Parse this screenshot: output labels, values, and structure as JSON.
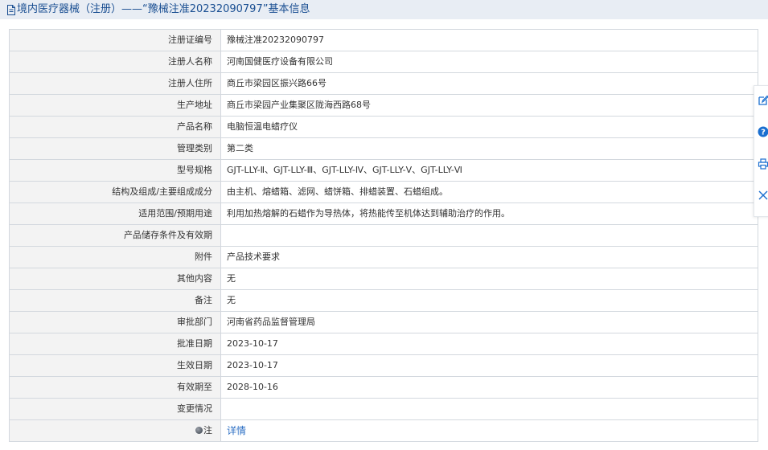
{
  "header": {
    "title": "境内医疗器械（注册）——“豫械注准20232090797”基本信息"
  },
  "rows": [
    {
      "label": "注册证编号",
      "value": "豫械注准20232090797"
    },
    {
      "label": "注册人名称",
      "value": "河南国健医疗设备有限公司"
    },
    {
      "label": "注册人住所",
      "value": "商丘市梁园区振兴路66号"
    },
    {
      "label": "生产地址",
      "value": "商丘市梁园产业集聚区陇海西路68号"
    },
    {
      "label": "产品名称",
      "value": "电脑恒温电蜡疗仪"
    },
    {
      "label": "管理类别",
      "value": "第二类"
    },
    {
      "label": "型号规格",
      "value": "GJT-LLY-Ⅱ、GJT-LLY-Ⅲ、GJT-LLY-Ⅳ、GJT-LLY-Ⅴ、GJT-LLY-Ⅵ"
    },
    {
      "label": "结构及组成/主要组成成分",
      "value": "由主机、熔蜡箱、滤网、蜡饼箱、排蜡装置、石蜡组成。"
    },
    {
      "label": "适用范围/预期用途",
      "value": "利用加热熔解的石蜡作为导热体，将热能传至机体达到辅助治疗的作用。"
    },
    {
      "label": "产品储存条件及有效期",
      "value": ""
    },
    {
      "label": "附件",
      "value": "产品技术要求"
    },
    {
      "label": "其他内容",
      "value": "无"
    },
    {
      "label": "备注",
      "value": "无"
    },
    {
      "label": "审批部门",
      "value": "河南省药品监督管理局"
    },
    {
      "label": "批准日期",
      "value": "2023-10-17"
    },
    {
      "label": "生效日期",
      "value": "2023-10-17"
    },
    {
      "label": "有效期至",
      "value": "2028-10-16"
    },
    {
      "label": "变更情况",
      "value": ""
    }
  ],
  "note_row": {
    "label": "注",
    "link_text": "详情"
  },
  "icons": {
    "title": "document-icon",
    "note": "pin-icon",
    "side_tools": [
      "edit-icon",
      "help-icon",
      "print-icon",
      "close-icon"
    ]
  },
  "colors": {
    "title_text": "#1a4f92",
    "title_bar_bg": "#e8edf4",
    "label_bg": "#f3f3f3",
    "border": "#d3d8de",
    "link": "#2c6fc4",
    "tool_icon": "#1a6fd0"
  }
}
